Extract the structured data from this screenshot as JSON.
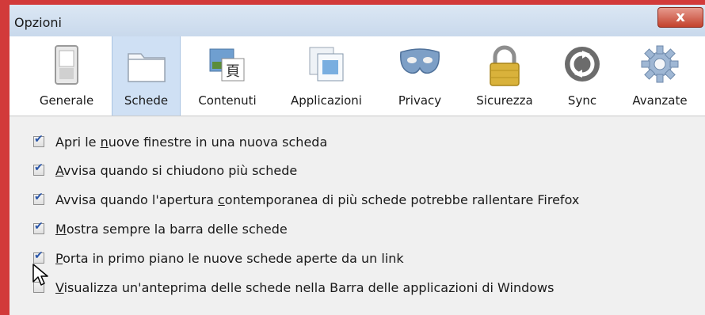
{
  "window": {
    "title": "Opzioni",
    "close_label": "x"
  },
  "toolbar": {
    "tabs": [
      {
        "label": "Generale",
        "icon": "switch-icon",
        "active": false
      },
      {
        "label": "Schede",
        "icon": "folder-tabs-icon",
        "active": true
      },
      {
        "label": "Contenuti",
        "icon": "content-icon",
        "active": false
      },
      {
        "label": "Applicazioni",
        "icon": "applications-icon",
        "active": false
      },
      {
        "label": "Privacy",
        "icon": "mask-icon",
        "active": false
      },
      {
        "label": "Sicurezza",
        "icon": "lock-icon",
        "active": false
      },
      {
        "label": "Sync",
        "icon": "sync-icon",
        "active": false
      },
      {
        "label": "Avanzate",
        "icon": "gear-icon",
        "active": false
      }
    ]
  },
  "options": [
    {
      "pre": "Apri le ",
      "u": "n",
      "post": "uove finestre in una nuova scheda",
      "checked": true
    },
    {
      "pre": "",
      "u": "A",
      "post": "vvisa quando si chiudono più schede",
      "checked": true
    },
    {
      "pre": "Avvisa quando l'apertura ",
      "u": "c",
      "post": "ontemporanea di più schede potrebbe rallentare Firefox",
      "checked": true
    },
    {
      "pre": "",
      "u": "M",
      "post": "ostra sempre la barra delle schede",
      "checked": true
    },
    {
      "pre": "",
      "u": "P",
      "post": "orta in primo piano le nuove schede aperte da un link",
      "checked": true
    },
    {
      "pre": "",
      "u": "V",
      "post": "isualizza un'anteprima delle schede nella Barra delle applicazioni di Windows",
      "checked": false
    }
  ],
  "colors": {
    "active_tab": "#cfe0f4",
    "frame": "#d23a3a",
    "check": "#2a56a8"
  }
}
